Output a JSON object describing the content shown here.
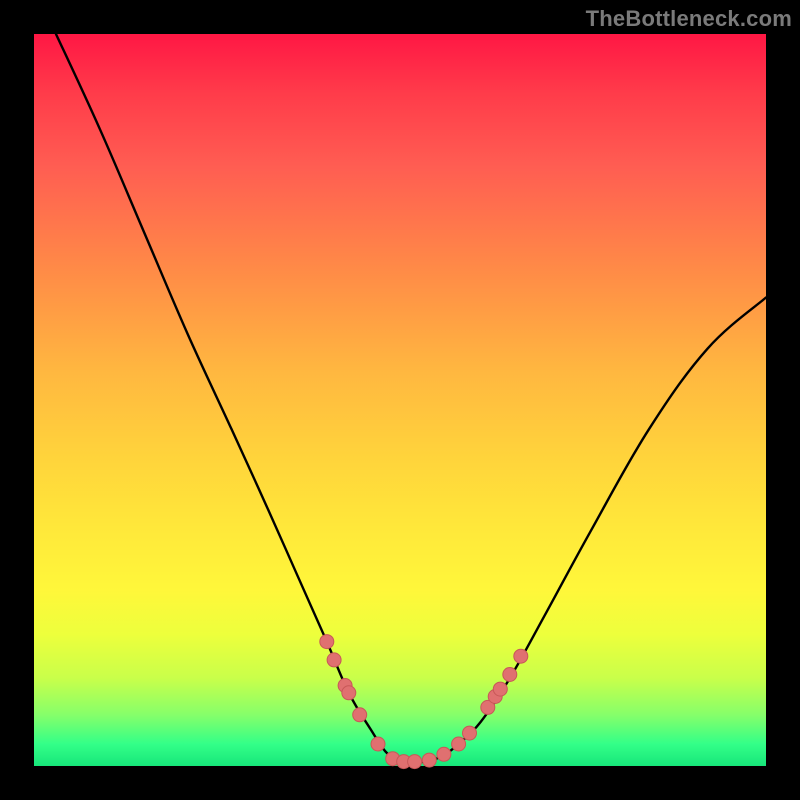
{
  "watermark": "TheBottleneck.com",
  "colors": {
    "frame": "#000000",
    "gradient_top": "#ff1744",
    "gradient_mid": "#ffe93a",
    "gradient_bottom": "#17e67a",
    "curve": "#000000",
    "dot_fill": "#e07070",
    "dot_stroke": "#c85858"
  },
  "chart_data": {
    "type": "line",
    "title": "",
    "xlabel": "",
    "ylabel": "",
    "xlim": [
      0,
      100
    ],
    "ylim": [
      0,
      100
    ],
    "series": [
      {
        "name": "bottleneck-curve",
        "x": [
          3,
          9,
          15,
          21,
          27,
          32,
          36,
          40,
          43,
          46,
          48,
          50,
          52,
          54,
          56,
          58,
          61,
          65,
          70,
          76,
          84,
          92,
          100
        ],
        "y": [
          100,
          87,
          73,
          59,
          46,
          35,
          26,
          17,
          10,
          5,
          2,
          0.5,
          0.5,
          0.7,
          1.5,
          3,
          6,
          12,
          21,
          32,
          46,
          57,
          64
        ]
      }
    ],
    "marker_points": [
      {
        "x": 40,
        "y": 17
      },
      {
        "x": 41,
        "y": 14.5
      },
      {
        "x": 42.5,
        "y": 11
      },
      {
        "x": 43,
        "y": 10
      },
      {
        "x": 44.5,
        "y": 7
      },
      {
        "x": 47,
        "y": 3
      },
      {
        "x": 49,
        "y": 1
      },
      {
        "x": 50.5,
        "y": 0.6
      },
      {
        "x": 52,
        "y": 0.6
      },
      {
        "x": 54,
        "y": 0.8
      },
      {
        "x": 56,
        "y": 1.6
      },
      {
        "x": 58,
        "y": 3
      },
      {
        "x": 59.5,
        "y": 4.5
      },
      {
        "x": 62,
        "y": 8
      },
      {
        "x": 63,
        "y": 9.5
      },
      {
        "x": 63.7,
        "y": 10.5
      },
      {
        "x": 65,
        "y": 12.5
      },
      {
        "x": 66.5,
        "y": 15
      }
    ]
  }
}
